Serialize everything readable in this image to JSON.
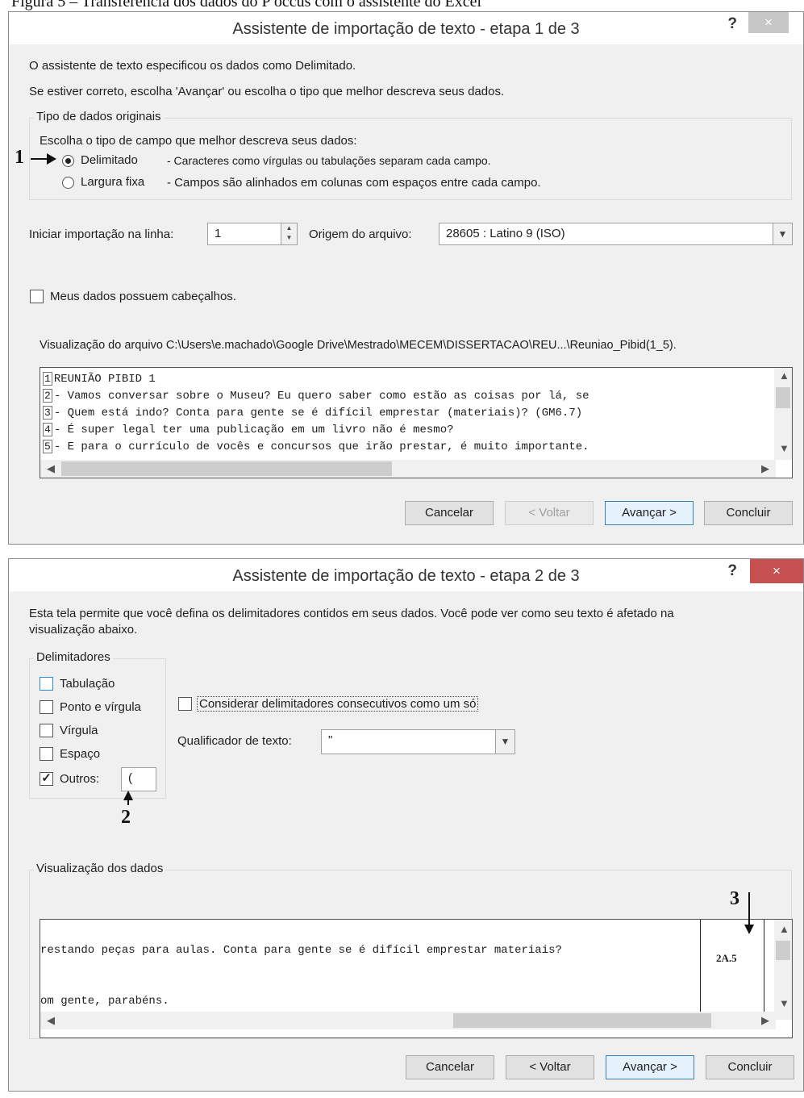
{
  "caption": "Figura 5 – Transferência dos dados do P occus com o assistente do Excel",
  "dialog1": {
    "title": "Assistente de importação de texto - etapa 1 de 3",
    "help": "?",
    "close": "×",
    "intro1": "O assistente de texto especificou os dados como Delimitado.",
    "intro2": "Se estiver correto, escolha 'Avançar' ou escolha o tipo que melhor descreva seus dados.",
    "group_label": "Tipo de dados originais",
    "group_prompt": "Escolha o tipo de campo que melhor descreva seus dados:",
    "radio_delim_label": "Delimitado",
    "radio_delim_desc": "- Caracteres como vírgulas ou tabulações separam cada campo.",
    "radio_fixed_label": "Largura fixa",
    "radio_fixed_desc": "- Campos são alinhados em colunas com espaços entre cada campo.",
    "start_row_label": "Iniciar importação na linha:",
    "start_row_value": "1",
    "origin_label": "Origem do arquivo:",
    "origin_value": "28605 : Latino 9 (ISO)",
    "headers_label": "Meus dados possuem cabeçalhos.",
    "preview_label": "Visualização do arquivo C:\\Users\\e.machado\\Google Drive\\Mestrado\\MECEM\\DISSERTACAO\\REU...\\Reuniao_Pibid(1_5).",
    "preview_lines": [
      {
        "n": "1",
        "text": "REUNIÃO PIBID 1"
      },
      {
        "n": "2",
        "text": "- Vamos conversar sobre o Museu? Eu quero saber como estão as coisas por lá, se"
      },
      {
        "n": "3",
        "text": "- Quem está indo? Conta para gente se é difícil emprestar (materiais)? (GM6.7)"
      },
      {
        "n": "4",
        "text": "- É super legal ter uma publicação em um livro não é mesmo?"
      },
      {
        "n": "5",
        "text": "- E para o currículo de vocês e concursos que irão prestar, é muito importante."
      }
    ],
    "buttons": {
      "cancel": "Cancelar",
      "back": "< Voltar",
      "next": "Avançar >",
      "finish": "Concluir"
    }
  },
  "dialog2": {
    "title": "Assistente de importação de texto - etapa 2 de 3",
    "help": "?",
    "close": "×",
    "intro": "Esta tela permite que você defina os delimitadores contidos em seus dados. Você pode ver como seu texto é afetado na",
    "intro2": "visualização abaixo.",
    "delim_group": "Delimitadores",
    "delims": [
      {
        "label": "Tabulação",
        "checked": false
      },
      {
        "label": "Ponto e vírgula",
        "checked": false
      },
      {
        "label": "Vírgula",
        "checked": false
      },
      {
        "label": "Espaço",
        "checked": false
      },
      {
        "label": "Outros:",
        "checked": true
      }
    ],
    "other_value": "(",
    "consecutive_label": "Considerar delimitadores consecutivos como um só",
    "qualifier_label": "Qualificador de texto:",
    "qualifier_value": "\"",
    "preview_group": "Visualização dos dados",
    "preview_lines": [
      "restando peças para aulas. Conta para gente se é difícil emprestar materiais?",
      "om gente, parabéns."
    ],
    "column2_value": "2A.5",
    "buttons": {
      "cancel": "Cancelar",
      "back": "< Voltar",
      "next": "Avançar >",
      "finish": "Concluir"
    }
  },
  "markers": {
    "m1": "1",
    "m2": "2",
    "m3": "3"
  }
}
